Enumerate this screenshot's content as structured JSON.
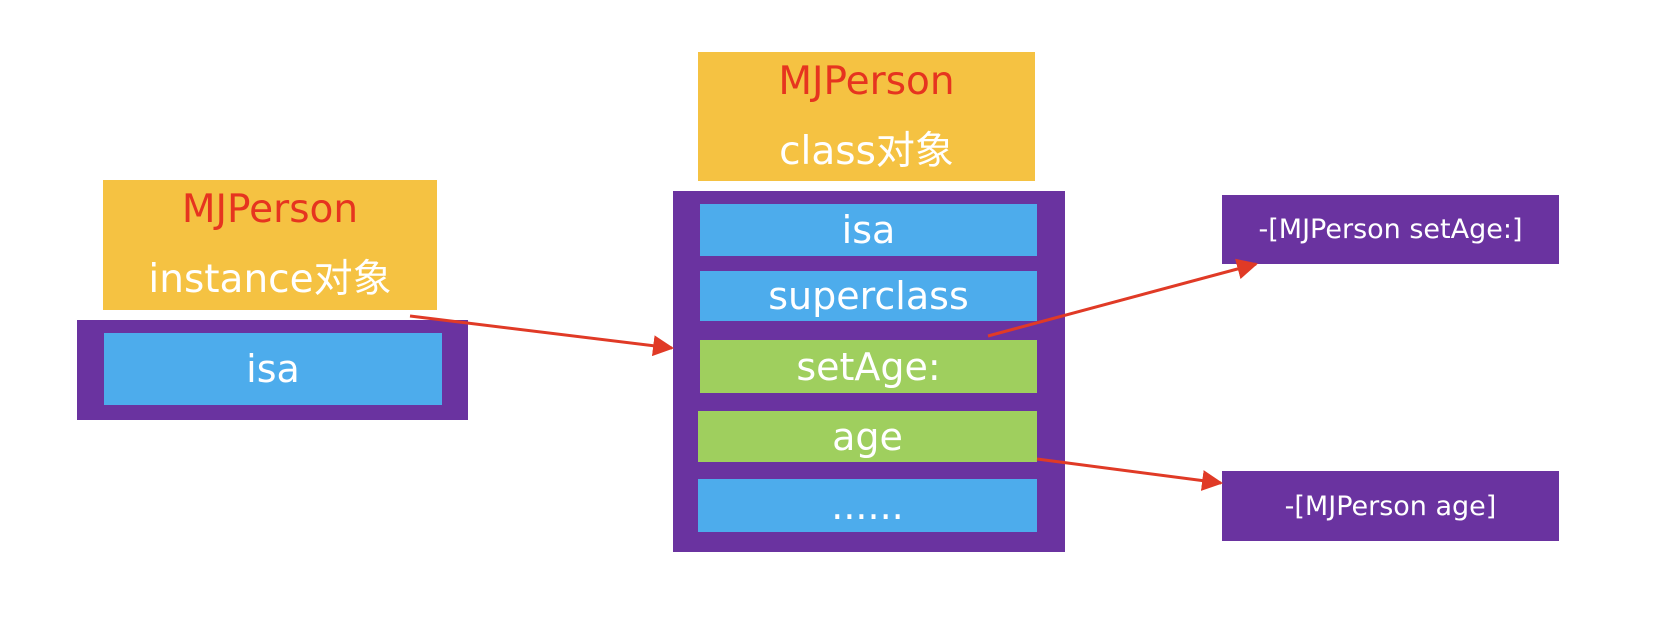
{
  "instance": {
    "title": "MJPerson",
    "subtitle": "instance对象",
    "fields": [
      "isa"
    ]
  },
  "class_object": {
    "title": "MJPerson",
    "subtitle": "class对象",
    "fields": [
      "isa",
      "superclass",
      "setAge:",
      "age",
      "......"
    ]
  },
  "methods": [
    "-[MJPerson setAge:]",
    "-[MJPerson age]"
  ],
  "colors": {
    "label_bg": "#F5C242",
    "title_text": "#E6341F",
    "container": "#6A33A0",
    "field_blue": "#4DACEC",
    "field_green": "#9FCF5E",
    "arrow": "#E03A26"
  }
}
